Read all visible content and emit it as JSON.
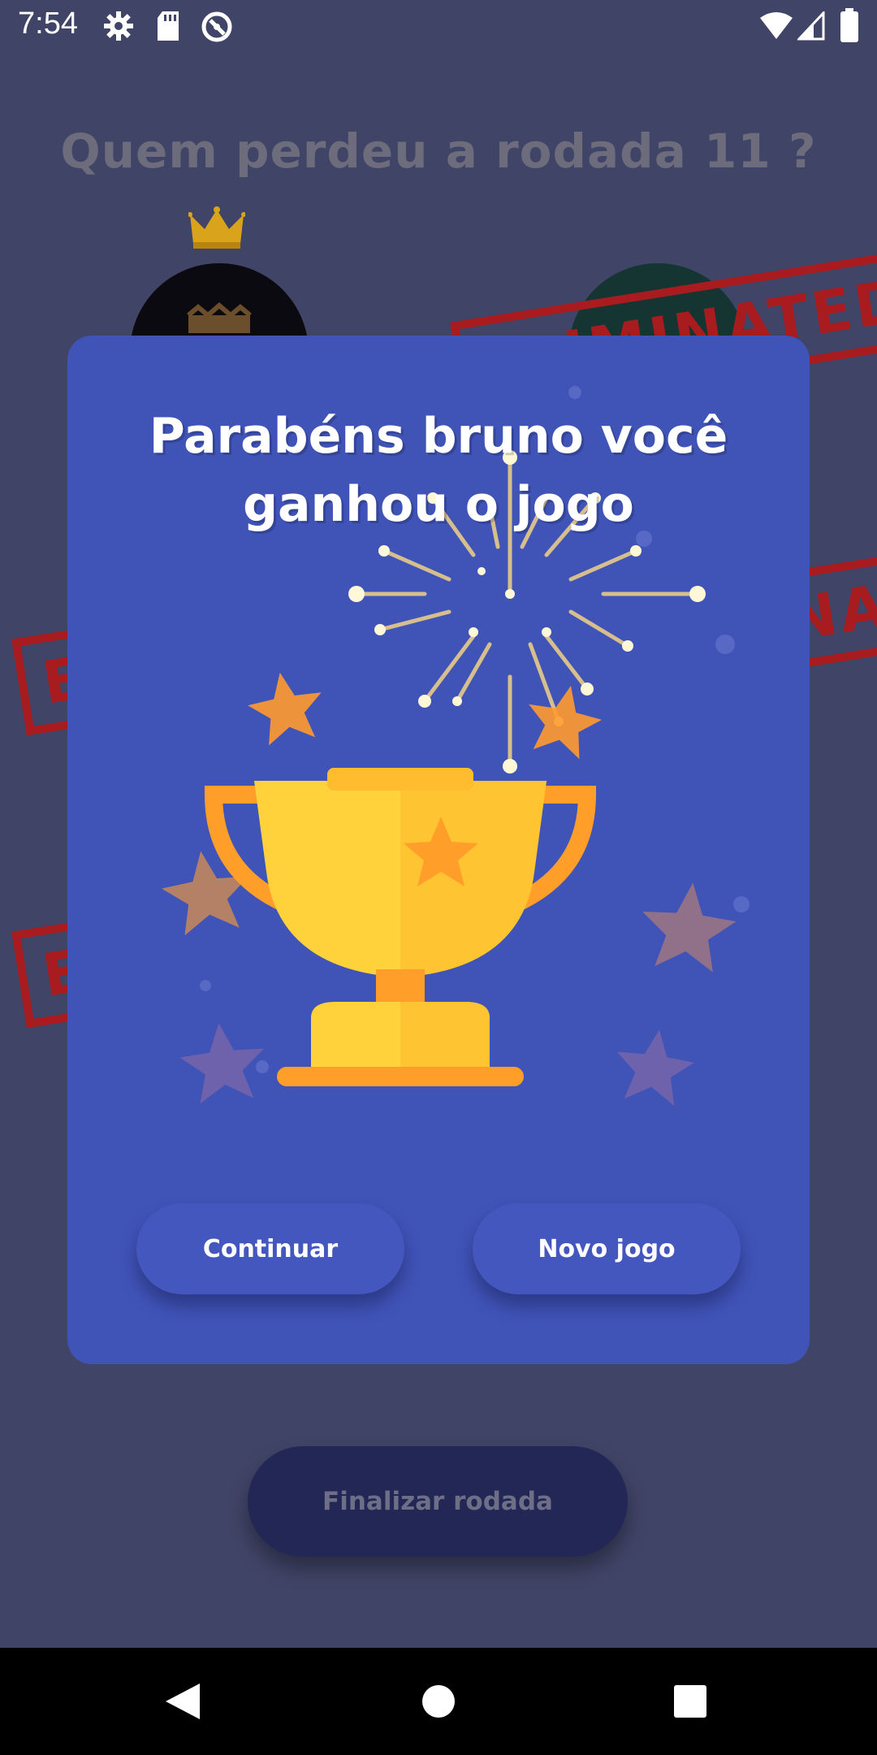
{
  "status_bar": {
    "time": "7:54",
    "icons": [
      "settings-icon",
      "sd-card-icon",
      "data-saver-icon",
      "wifi-icon",
      "signal-icon",
      "battery-icon"
    ]
  },
  "background": {
    "title": "Quem perdeu a rodada 11 ?",
    "stamp_text": "ELIMINATED",
    "finalize_button": "Finalizar rodada"
  },
  "dialog": {
    "title_line1": "Parabéns bruno você",
    "title_line2": "ganhou o jogo",
    "continue_button": "Continuar",
    "new_game_button": "Novo jogo",
    "illustration": "trophy-icon"
  },
  "nav_bar": {
    "icons": [
      "back-icon",
      "home-icon",
      "recents-icon"
    ]
  },
  "colors": {
    "background": "#404466",
    "dialog": "#4054b8",
    "button": "#4357bf",
    "stamp": "#a81c1f",
    "trophy": "#ffc533"
  }
}
